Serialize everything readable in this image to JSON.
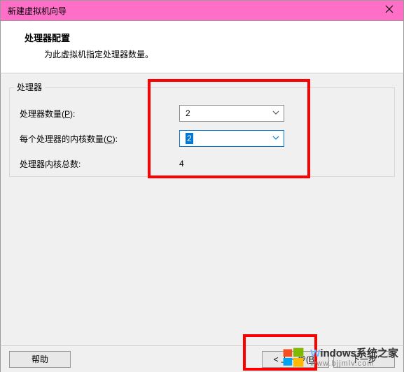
{
  "titlebar": {
    "title": "新建虚拟机向导"
  },
  "header": {
    "title": "处理器配置",
    "subtitle": "为此虚拟机指定处理器数量。"
  },
  "group": {
    "title": "处理器",
    "row1_prefix": "处理器数量(",
    "row1_hot": "P",
    "row1_suffix": "):",
    "row2_prefix": "每个处理器的内核数量(",
    "row2_hot": "C",
    "row2_suffix": "):",
    "row3_label": "处理器内核总数:",
    "value1": "2",
    "value2": "2",
    "total": "4"
  },
  "footer": {
    "help": "帮助",
    "back_prefix": "< 上一步(",
    "back_hot": "B",
    "back_suffix": ")",
    "next": "下一步"
  },
  "watermark": {
    "line1_w": "W",
    "line1_rest": "indows系统之家",
    "line2": "www.bjjmlv.com"
  }
}
